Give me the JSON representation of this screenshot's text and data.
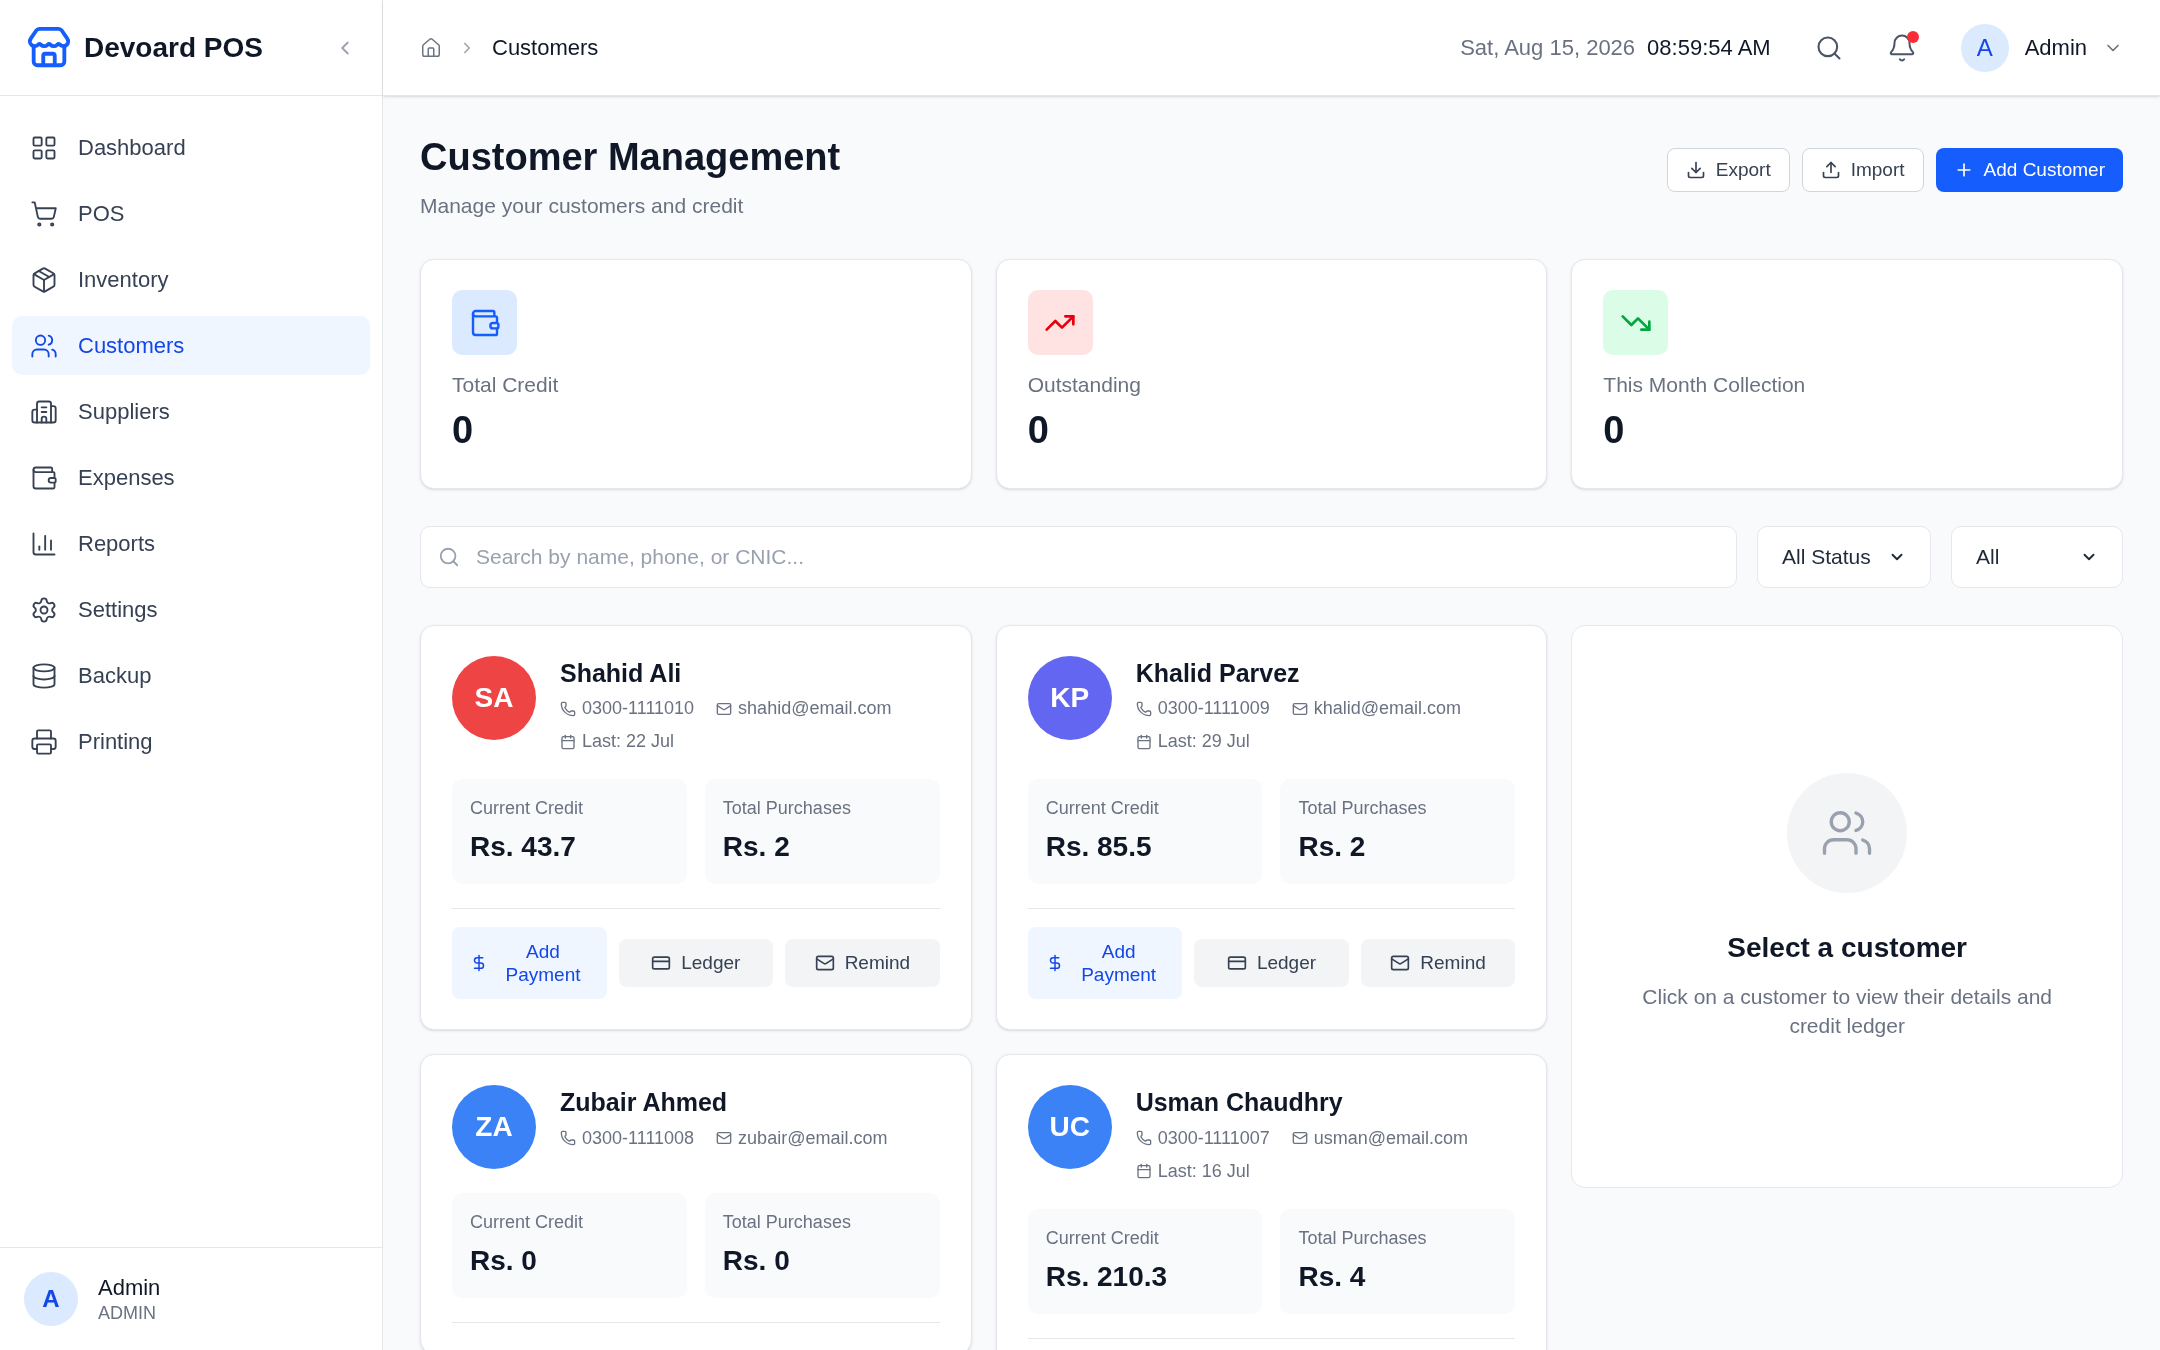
{
  "sidebar": {
    "brand": "Devoard POS",
    "items": [
      {
        "label": "Dashboard",
        "selected": false
      },
      {
        "label": "POS",
        "selected": false
      },
      {
        "label": "Inventory",
        "selected": false
      },
      {
        "label": "Customers",
        "selected": true
      },
      {
        "label": "Suppliers",
        "selected": false
      },
      {
        "label": "Expenses",
        "selected": false
      },
      {
        "label": "Reports",
        "selected": false
      },
      {
        "label": "Settings",
        "selected": false
      },
      {
        "label": "Backup",
        "selected": false
      },
      {
        "label": "Printing",
        "selected": false
      }
    ],
    "user": {
      "initial": "A",
      "name": "Admin",
      "role": "ADMIN"
    }
  },
  "header": {
    "breadcrumb": "Customers",
    "date": "Sat, Aug 15, 2026",
    "time": "08:59:54 AM",
    "notification_dot": true,
    "user": {
      "initial": "A",
      "name": "Admin"
    }
  },
  "page": {
    "title": "Customer Management",
    "subtitle": "Manage your customers and credit",
    "buttons": [
      {
        "label": "Export",
        "kind": "export"
      },
      {
        "label": "Import",
        "kind": "import"
      },
      {
        "label": "Add Customer",
        "kind": "primary"
      }
    ]
  },
  "stats": [
    {
      "label": "Total Credit",
      "value": "0",
      "kind": "credit"
    },
    {
      "label": "Outstanding",
      "value": "0",
      "kind": "up"
    },
    {
      "label": "This Month Collection",
      "value": "0",
      "kind": "down"
    }
  ],
  "filters": {
    "search_placeholder": "Search by name, phone, or CNIC...",
    "status": "All Status",
    "type": "All"
  },
  "customers": [
    {
      "initials": "SA",
      "color": "#ef4444",
      "name": "Shahid Ali",
      "phone": "0300-1111010",
      "email": "shahid@email.com",
      "last": "Last: 22 Jul",
      "credit_label": "Current Credit",
      "credit": "Rs. 43.7",
      "purchases_label": "Total Purchases",
      "purchases": "Rs. 2",
      "actions": [
        "Add Payment",
        "Ledger",
        "Remind"
      ]
    },
    {
      "initials": "KP",
      "color": "#6366f1",
      "name": "Khalid Parvez",
      "phone": "0300-1111009",
      "email": "khalid@email.com",
      "last": "Last: 29 Jul",
      "credit_label": "Current Credit",
      "credit": "Rs. 85.5",
      "purchases_label": "Total Purchases",
      "purchases": "Rs. 2",
      "actions": [
        "Add Payment",
        "Ledger",
        "Remind"
      ]
    },
    {
      "initials": "ZA",
      "color": "#3b82f6",
      "name": "Zubair Ahmed",
      "phone": "0300-1111008",
      "email": "zubair@email.com",
      "credit_label": "Current Credit",
      "credit": "Rs. 0",
      "purchases_label": "Total Purchases",
      "purchases": "Rs. 0"
    },
    {
      "initials": "UC",
      "color": "#3b82f6",
      "name": "Usman Chaudhry",
      "phone": "0300-1111007",
      "email": "usman@email.com",
      "last": "Last: 16 Jul",
      "credit_label": "Current Credit",
      "credit": "Rs. 210.3",
      "purchases_label": "Total Purchases",
      "purchases": "Rs. 4"
    }
  ],
  "detail": {
    "title": "Select a customer",
    "text": "Click on a customer to view their details and credit ledger"
  }
}
